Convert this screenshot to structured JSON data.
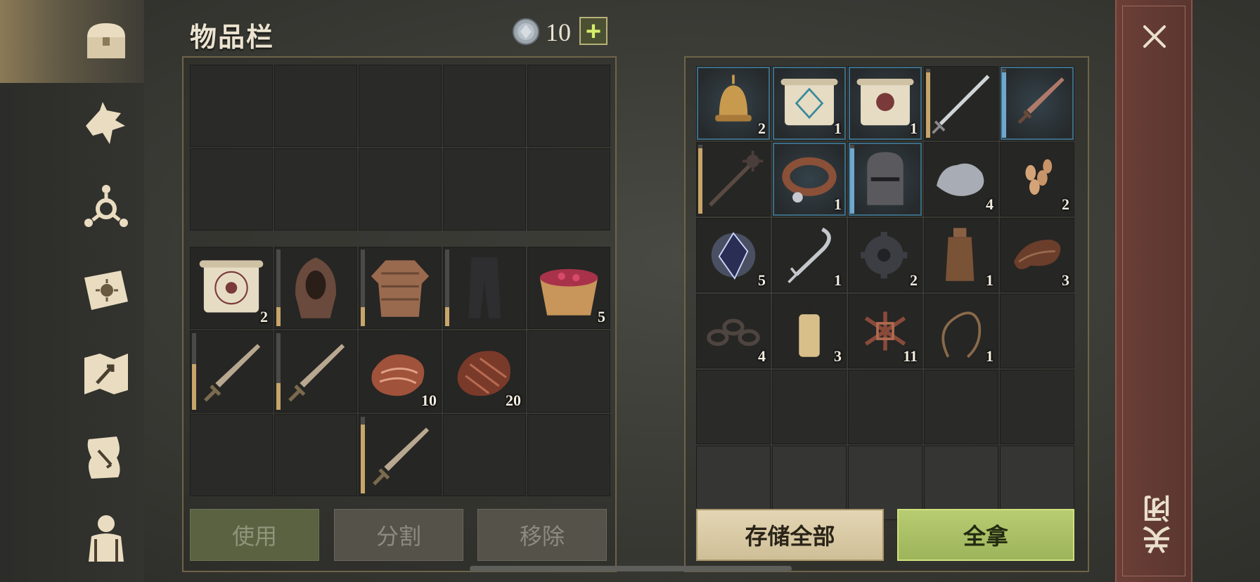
{
  "header": {
    "title": "物品栏",
    "coin_count": "10",
    "plus_label": "+"
  },
  "sidebar": {
    "items": [
      {
        "name": "chest-icon",
        "active": true
      },
      {
        "name": "wolf-icon"
      },
      {
        "name": "skills-icon"
      },
      {
        "name": "sun-book-icon"
      },
      {
        "name": "map-icon"
      },
      {
        "name": "quest-scroll-icon"
      },
      {
        "name": "character-icon"
      }
    ]
  },
  "inventory": {
    "equip_rows": 2,
    "items": [
      {
        "icon": "scroll-icon",
        "count": "2"
      },
      {
        "icon": "hood-icon",
        "durability": 0.25
      },
      {
        "icon": "chainmail-icon",
        "durability": 0.25
      },
      {
        "icon": "pants-icon",
        "durability": 0.25
      },
      {
        "icon": "berry-bowl-icon",
        "count": "5"
      },
      {
        "icon": "sword-icon",
        "durability": 0.6
      },
      {
        "icon": "sword-icon",
        "durability": 0.35
      },
      {
        "icon": "raw-meat-icon",
        "count": "10"
      },
      {
        "icon": "steak-icon",
        "count": "20"
      },
      {
        "icon": "empty"
      },
      {
        "icon": "empty"
      },
      {
        "icon": "empty"
      },
      {
        "icon": "sword-icon",
        "durability": 0.9
      },
      {
        "icon": "empty"
      },
      {
        "icon": "empty"
      }
    ],
    "buttons": {
      "use": "使用",
      "split": "分割",
      "remove": "移除"
    }
  },
  "storage": {
    "items": [
      {
        "icon": "bell-icon",
        "count": "2",
        "rare": true
      },
      {
        "icon": "rune-scroll-icon",
        "count": "1",
        "rare": true
      },
      {
        "icon": "skull-scroll-icon",
        "count": "1",
        "rare": true
      },
      {
        "icon": "longsword-icon",
        "durability": 0.95
      },
      {
        "icon": "dagger-icon",
        "durability": 0.95,
        "rare": true,
        "dur_color": "blue"
      },
      {
        "icon": "mace-icon",
        "durability": 0.95
      },
      {
        "icon": "collar-icon",
        "count": "1",
        "rare": true
      },
      {
        "icon": "helmet-icon",
        "durability": 0.95,
        "rare": true,
        "dur_color": "blue"
      },
      {
        "icon": "stone-icon",
        "count": "4"
      },
      {
        "icon": "seeds-icon",
        "count": "2"
      },
      {
        "icon": "crystal-icon",
        "count": "5"
      },
      {
        "icon": "fork-icon",
        "count": "1"
      },
      {
        "icon": "gear-icon",
        "count": "2"
      },
      {
        "icon": "bottle-icon",
        "count": "1"
      },
      {
        "icon": "leather-icon",
        "count": "3"
      },
      {
        "icon": "chain-icon",
        "count": "4"
      },
      {
        "icon": "candle-icon",
        "count": "3"
      },
      {
        "icon": "scrap-icon",
        "count": "11"
      },
      {
        "icon": "rope-icon",
        "count": "1"
      },
      {
        "icon": "empty"
      }
    ],
    "buttons": {
      "store_all": "存储全部",
      "take_all": "全拿"
    }
  },
  "close": {
    "label": "关闭"
  },
  "colors": {
    "accent_gold": "#c8a56a",
    "rare_blue": "#3d6d86",
    "take_green": "#9eb45a",
    "close_red": "#6b3f36"
  }
}
